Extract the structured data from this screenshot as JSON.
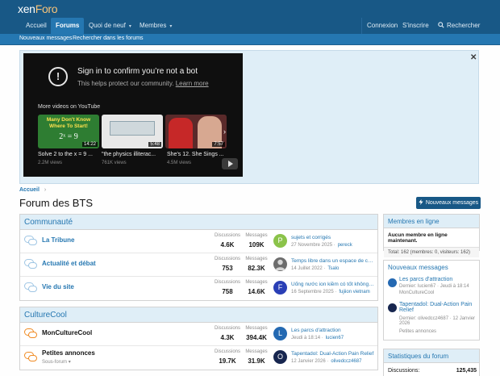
{
  "header": {
    "logo_main": "xen",
    "logo_accent": "Foro"
  },
  "nav": {
    "items": [
      {
        "label": "Accueil"
      },
      {
        "label": "Forums"
      },
      {
        "label": "Quoi de neuf",
        "caret": "▾"
      },
      {
        "label": "Membres",
        "caret": "▾"
      }
    ],
    "login": "Connexion",
    "register": "S'inscrire",
    "search": "Rechercher"
  },
  "subnav": {
    "new_posts": "Nouveaux messages",
    "search_forums": "Rechercher dans les forums"
  },
  "notice": {
    "close": "✕",
    "youtube": {
      "title": "Sign in to confirm you’re not a bot",
      "sub_prefix": "This helps protect our community.",
      "learn_more": "Learn more",
      "more_videos": "More videos on YouTube",
      "videos": [
        {
          "thumb_text_1": "Many Don't Know",
          "thumb_text_2": "Where To Start!",
          "thumb_text_3": "2ˣ = 9",
          "duration": "14:22",
          "caption": "Solve 2 to the x = 9 ...",
          "views": "2.2M views"
        },
        {
          "duration": "5:48",
          "caption": "\"the physics illiterac...",
          "views": "761K views"
        },
        {
          "duration": "7:57",
          "caption": "She's 12. She Sings ...",
          "views": "4.5M views"
        }
      ]
    }
  },
  "breadcrumb": {
    "home": "Accueil",
    "sep": "›"
  },
  "page_title": "Forum des BTS",
  "new_posts_button": "Nouveaux messages",
  "categories": [
    {
      "title": "Communauté",
      "forums": [
        {
          "name": "La Tribune",
          "discussions": "4.6K",
          "messages": "109K",
          "avatar_letter": "P",
          "avatar_color": "#8bc34a",
          "last_title": "sujets et corrigés",
          "last_date": "27 Novembre 2025",
          "last_user": "pereck"
        },
        {
          "name": "Actualité et débat",
          "discussions": "753",
          "messages": "82.3K",
          "avatar_letter": "",
          "avatar_color": "#6d6d6d",
          "last_title": "Temps libre dans un espace de co...",
          "last_date": "14 Juillet 2022",
          "last_user": "Tsalo"
        },
        {
          "name": "Vie du site",
          "discussions": "758",
          "messages": "14.6K",
          "avatar_letter": "F",
          "avatar_color": "#2a3fb6",
          "last_title": "Uống nước ion kiềm có tốt không?...",
          "last_date": "16 Septembre 2025",
          "last_user": "fujiion vietnam"
        }
      ]
    },
    {
      "title": "CultureCool",
      "forums": [
        {
          "name": "MonCultureCool",
          "discussions": "4.3K",
          "messages": "394.4K",
          "avatar_letter": "L",
          "avatar_color": "#2469b2",
          "last_title": "Les parcs d'attraction",
          "last_date": "Jeudi à 18:14",
          "last_user": "lucien67"
        },
        {
          "name": "Petites annonces",
          "sub": "Sous-forum",
          "discussions": "19.7K",
          "messages": "31.9K",
          "avatar_letter": "O",
          "avatar_color": "#17264f",
          "last_title": "Tapentadol: Dual-Action Pain Relief",
          "last_date": "12 Janvier 2026",
          "last_user": "olivedccz4687"
        }
      ]
    }
  ],
  "labels": {
    "discussions": "Discussions",
    "messages": "Messages"
  },
  "sidebar": {
    "online": {
      "title": "Membres en ligne",
      "text": "Aucun membre en ligne maintenant.",
      "total": "Total: 162 (membres: 0, visiteurs: 162)"
    },
    "new_posts": {
      "title": "Nouveaux messages",
      "items": [
        {
          "title": "Les parcs d'attraction",
          "meta1": "Dernier: lucien67 · Jeudi à 18:14",
          "meta2": "MonCultureCool"
        },
        {
          "title": "Tapentadol: Dual-Action Pain Relief",
          "meta1": "Dernier: olivedccz4687 · 12 Janvier 2026",
          "meta2": "Petites annonces"
        }
      ]
    },
    "stats": {
      "title": "Statistiques du forum",
      "discussions_label": "Discussions:",
      "discussions_value": "125,435"
    }
  }
}
